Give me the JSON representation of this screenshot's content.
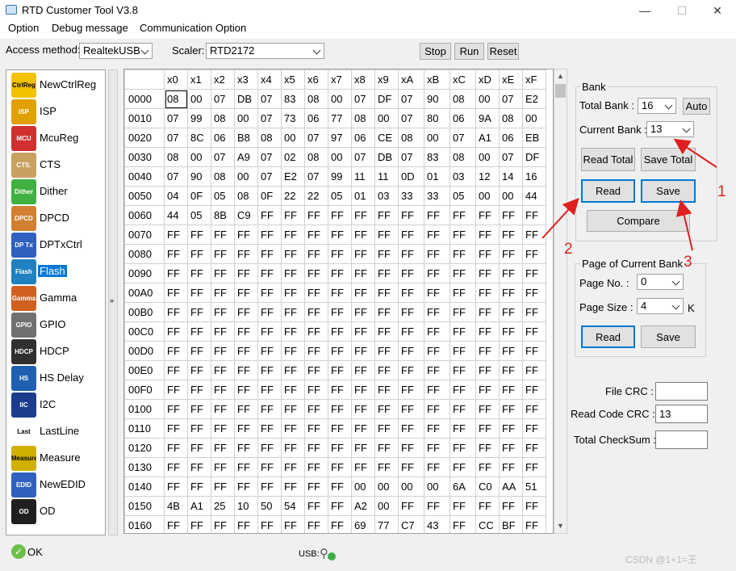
{
  "window": {
    "title": "RTD Customer Tool V3.8",
    "min": "—",
    "max": "☐",
    "close": "✕"
  },
  "menu": [
    "Option",
    "Debug message",
    "Communication Option"
  ],
  "toolbar": {
    "access_label": "Access method:",
    "access_value": "RealtekUSB",
    "scaler_label": "Scaler:",
    "scaler_value": "RTD2172",
    "stop": "Stop",
    "run": "Run",
    "reset": "Reset"
  },
  "sidebar": {
    "items": [
      {
        "label": "NewCtrlReg",
        "icon": "CtrlReg",
        "color": "#f2c200"
      },
      {
        "label": "ISP",
        "icon": "ISP",
        "color": "#e0a000"
      },
      {
        "label": "McuReg",
        "icon": "MCU",
        "color": "#d03030"
      },
      {
        "label": "CTS",
        "icon": "CTS.",
        "color": "#c8a060"
      },
      {
        "label": "Dither",
        "icon": "Dither",
        "color": "#40b040"
      },
      {
        "label": "DPCD",
        "icon": "DPCD",
        "color": "#d08030"
      },
      {
        "label": "DPTxCtrl",
        "icon": "DP Tx",
        "color": "#3060c0"
      },
      {
        "label": "Flash",
        "icon": "Flash",
        "color": "#2080c0"
      },
      {
        "label": "Gamma",
        "icon": "Gamma",
        "color": "#d06020"
      },
      {
        "label": "GPIO",
        "icon": "GPIO",
        "color": "#707070"
      },
      {
        "label": "HDCP",
        "icon": "HDCP",
        "color": "#303030"
      },
      {
        "label": "HS Delay",
        "icon": "HS Delay",
        "color": "#2060b0"
      },
      {
        "label": "I2C",
        "icon": "IIC",
        "color": "#1c3c8c"
      },
      {
        "label": "LastLine",
        "icon": "Last Line",
        "color": "#ffffff"
      },
      {
        "label": "Measure",
        "icon": "Measure",
        "color": "#d0b000"
      },
      {
        "label": "NewEDID",
        "icon": "EDID",
        "color": "#3060c0"
      },
      {
        "label": "OD",
        "icon": "OD",
        "color": "#202020"
      }
    ],
    "active_index": 7,
    "collapse_glyph": "»"
  },
  "grid": {
    "columns": [
      "x0",
      "x1",
      "x2",
      "x3",
      "x4",
      "x5",
      "x6",
      "x7",
      "x8",
      "x9",
      "xA",
      "xB",
      "xC",
      "xD",
      "xE",
      "xF"
    ],
    "rows": [
      {
        "addr": "0000",
        "cells": [
          "08",
          "00",
          "07",
          "DB",
          "07",
          "83",
          "08",
          "00",
          "07",
          "DF",
          "07",
          "90",
          "08",
          "00",
          "07",
          "E2"
        ]
      },
      {
        "addr": "0010",
        "cells": [
          "07",
          "99",
          "08",
          "00",
          "07",
          "73",
          "06",
          "77",
          "08",
          "00",
          "07",
          "80",
          "06",
          "9A",
          "08",
          "00"
        ]
      },
      {
        "addr": "0020",
        "cells": [
          "07",
          "8C",
          "06",
          "B8",
          "08",
          "00",
          "07",
          "97",
          "06",
          "CE",
          "08",
          "00",
          "07",
          "A1",
          "06",
          "EB"
        ]
      },
      {
        "addr": "0030",
        "cells": [
          "08",
          "00",
          "07",
          "A9",
          "07",
          "02",
          "08",
          "00",
          "07",
          "DB",
          "07",
          "83",
          "08",
          "00",
          "07",
          "DF"
        ]
      },
      {
        "addr": "0040",
        "cells": [
          "07",
          "90",
          "08",
          "00",
          "07",
          "E2",
          "07",
          "99",
          "11",
          "11",
          "0D",
          "01",
          "03",
          "12",
          "14",
          "16"
        ]
      },
      {
        "addr": "0050",
        "cells": [
          "04",
          "0F",
          "05",
          "08",
          "0F",
          "22",
          "22",
          "05",
          "01",
          "03",
          "33",
          "33",
          "05",
          "00",
          "00",
          "44"
        ]
      },
      {
        "addr": "0060",
        "cells": [
          "44",
          "05",
          "8B",
          "C9",
          "FF",
          "FF",
          "FF",
          "FF",
          "FF",
          "FF",
          "FF",
          "FF",
          "FF",
          "FF",
          "FF",
          "FF"
        ]
      },
      {
        "addr": "0070",
        "cells": [
          "FF",
          "FF",
          "FF",
          "FF",
          "FF",
          "FF",
          "FF",
          "FF",
          "FF",
          "FF",
          "FF",
          "FF",
          "FF",
          "FF",
          "FF",
          "FF"
        ]
      },
      {
        "addr": "0080",
        "cells": [
          "FF",
          "FF",
          "FF",
          "FF",
          "FF",
          "FF",
          "FF",
          "FF",
          "FF",
          "FF",
          "FF",
          "FF",
          "FF",
          "FF",
          "FF",
          "FF"
        ]
      },
      {
        "addr": "0090",
        "cells": [
          "FF",
          "FF",
          "FF",
          "FF",
          "FF",
          "FF",
          "FF",
          "FF",
          "FF",
          "FF",
          "FF",
          "FF",
          "FF",
          "FF",
          "FF",
          "FF"
        ]
      },
      {
        "addr": "00A0",
        "cells": [
          "FF",
          "FF",
          "FF",
          "FF",
          "FF",
          "FF",
          "FF",
          "FF",
          "FF",
          "FF",
          "FF",
          "FF",
          "FF",
          "FF",
          "FF",
          "FF"
        ]
      },
      {
        "addr": "00B0",
        "cells": [
          "FF",
          "FF",
          "FF",
          "FF",
          "FF",
          "FF",
          "FF",
          "FF",
          "FF",
          "FF",
          "FF",
          "FF",
          "FF",
          "FF",
          "FF",
          "FF"
        ]
      },
      {
        "addr": "00C0",
        "cells": [
          "FF",
          "FF",
          "FF",
          "FF",
          "FF",
          "FF",
          "FF",
          "FF",
          "FF",
          "FF",
          "FF",
          "FF",
          "FF",
          "FF",
          "FF",
          "FF"
        ]
      },
      {
        "addr": "00D0",
        "cells": [
          "FF",
          "FF",
          "FF",
          "FF",
          "FF",
          "FF",
          "FF",
          "FF",
          "FF",
          "FF",
          "FF",
          "FF",
          "FF",
          "FF",
          "FF",
          "FF"
        ]
      },
      {
        "addr": "00E0",
        "cells": [
          "FF",
          "FF",
          "FF",
          "FF",
          "FF",
          "FF",
          "FF",
          "FF",
          "FF",
          "FF",
          "FF",
          "FF",
          "FF",
          "FF",
          "FF",
          "FF"
        ]
      },
      {
        "addr": "00F0",
        "cells": [
          "FF",
          "FF",
          "FF",
          "FF",
          "FF",
          "FF",
          "FF",
          "FF",
          "FF",
          "FF",
          "FF",
          "FF",
          "FF",
          "FF",
          "FF",
          "FF"
        ]
      },
      {
        "addr": "0100",
        "cells": [
          "FF",
          "FF",
          "FF",
          "FF",
          "FF",
          "FF",
          "FF",
          "FF",
          "FF",
          "FF",
          "FF",
          "FF",
          "FF",
          "FF",
          "FF",
          "FF"
        ]
      },
      {
        "addr": "0110",
        "cells": [
          "FF",
          "FF",
          "FF",
          "FF",
          "FF",
          "FF",
          "FF",
          "FF",
          "FF",
          "FF",
          "FF",
          "FF",
          "FF",
          "FF",
          "FF",
          "FF"
        ]
      },
      {
        "addr": "0120",
        "cells": [
          "FF",
          "FF",
          "FF",
          "FF",
          "FF",
          "FF",
          "FF",
          "FF",
          "FF",
          "FF",
          "FF",
          "FF",
          "FF",
          "FF",
          "FF",
          "FF"
        ]
      },
      {
        "addr": "0130",
        "cells": [
          "FF",
          "FF",
          "FF",
          "FF",
          "FF",
          "FF",
          "FF",
          "FF",
          "FF",
          "FF",
          "FF",
          "FF",
          "FF",
          "FF",
          "FF",
          "FF"
        ]
      },
      {
        "addr": "0140",
        "cells": [
          "FF",
          "FF",
          "FF",
          "FF",
          "FF",
          "FF",
          "FF",
          "FF",
          "00",
          "00",
          "00",
          "00",
          "6A",
          "C0",
          "AA",
          "51"
        ]
      },
      {
        "addr": "0150",
        "cells": [
          "4B",
          "A1",
          "25",
          "10",
          "50",
          "54",
          "FF",
          "FF",
          "A2",
          "00",
          "FF",
          "FF",
          "FF",
          "FF",
          "FF",
          "FF"
        ]
      },
      {
        "addr": "0160",
        "cells": [
          "FF",
          "FF",
          "FF",
          "FF",
          "FF",
          "FF",
          "FF",
          "FF",
          "69",
          "77",
          "C7",
          "43",
          "FF",
          "CC",
          "BF",
          "FF"
        ]
      }
    ]
  },
  "bank": {
    "title": "Bank",
    "total_label": "Total Bank :",
    "total_value": "16",
    "auto": "Auto",
    "current_label": "Current Bank :",
    "current_value": "13",
    "read_total": "Read Total",
    "save_total": "Save Total",
    "read": "Read",
    "save": "Save",
    "compare": "Compare"
  },
  "page": {
    "title": "Page of Current Bank",
    "no_label": "Page No. :",
    "no_value": "0",
    "size_label": "Page Size :",
    "size_value": "4",
    "size_unit": "K",
    "read": "Read",
    "save": "Save"
  },
  "crc": {
    "file_label": "File CRC :",
    "file_value": "",
    "code_label": "Read Code CRC :",
    "code_value": "13",
    "checksum_label": "Total CheckSum :",
    "checksum_value": ""
  },
  "annotations": [
    "1",
    "2",
    "3"
  ],
  "status": {
    "ok": "OK",
    "usb": "USB:"
  },
  "watermark": "CSDN @1+1=王"
}
